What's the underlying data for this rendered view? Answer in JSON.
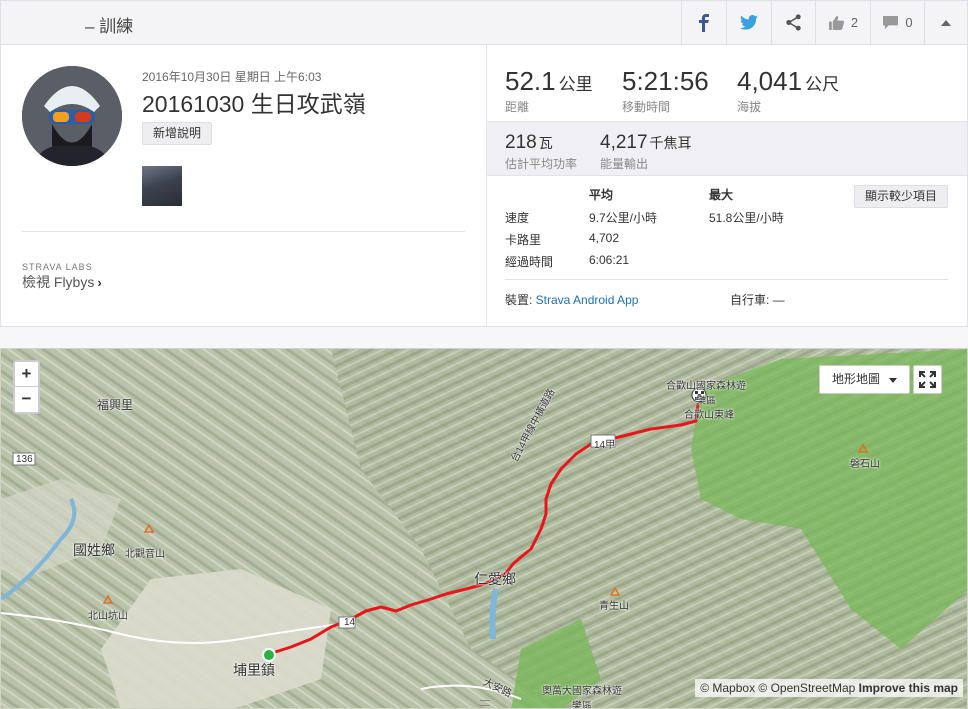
{
  "header": {
    "title": "– 訓練",
    "kudos_count": "2",
    "comment_count": "0",
    "icons": [
      "facebook-icon",
      "twitter-icon",
      "share-icon",
      "thumbs-up-icon",
      "comment-icon",
      "collapse-up-icon"
    ]
  },
  "activity": {
    "date": "2016年10月30日 星期日 上午6:03",
    "name": "20161030 生日攻武嶺",
    "add_description": "新增說明"
  },
  "labs": {
    "tag": "STRAVA LABS",
    "flybys": "檢視 Flybys"
  },
  "stats": {
    "distance": {
      "value": "52.1",
      "unit": "公里",
      "label": "距離"
    },
    "moving_time": {
      "value": "5:21:56",
      "label": "移動時間"
    },
    "elevation": {
      "value": "4,041",
      "unit": "公尺",
      "label": "海拔"
    }
  },
  "secondary": {
    "power": {
      "value": "218",
      "unit": "瓦",
      "label": "估計平均功率"
    },
    "energy": {
      "value": "4,217",
      "unit": "千焦耳",
      "label": "能量輸出"
    }
  },
  "details": {
    "col_avg": "平均",
    "col_max": "最大",
    "show_less": "顯示較少項目",
    "rows": [
      {
        "label": "速度",
        "avg": "9.7公里/小時",
        "max": "51.8公里/小時"
      },
      {
        "label": "卡路里",
        "avg": "4,702",
        "max": ""
      },
      {
        "label": "經過時間",
        "avg": "6:06:21",
        "max": ""
      }
    ],
    "device_label": "裝置: ",
    "device_value": "Strava Android App",
    "bike": "自行車: —"
  },
  "map": {
    "zoom_in": "+",
    "zoom_out": "−",
    "map_type": "地形地圖",
    "attribution_1": "© Mapbox © OpenStreetMap",
    "attribution_2": "Improve this map",
    "labels": {
      "fuxingli": "福興里",
      "road136": "136",
      "guoxing": "國姓鄉",
      "beiguanyin": "北觀音山",
      "beishankeng": "北山坑山",
      "puli": "埔里鎮",
      "renai": "仁愛鄉",
      "qingsheng": "青生山",
      "heguanshan_park": "合歡山國家森林遊樂區",
      "heguanshan_east": "合歡山東峰",
      "road14a": "14甲",
      "road14": "14",
      "panshi": "磐石山",
      "zhongheng": "台14甲線中橫道路",
      "aowanda": "奧萬大國家森林遊樂區",
      "daan_rd": "大安路"
    },
    "colors": {
      "route": "#e8161c",
      "start": "#26b53e",
      "forest": "#79b85a"
    }
  }
}
